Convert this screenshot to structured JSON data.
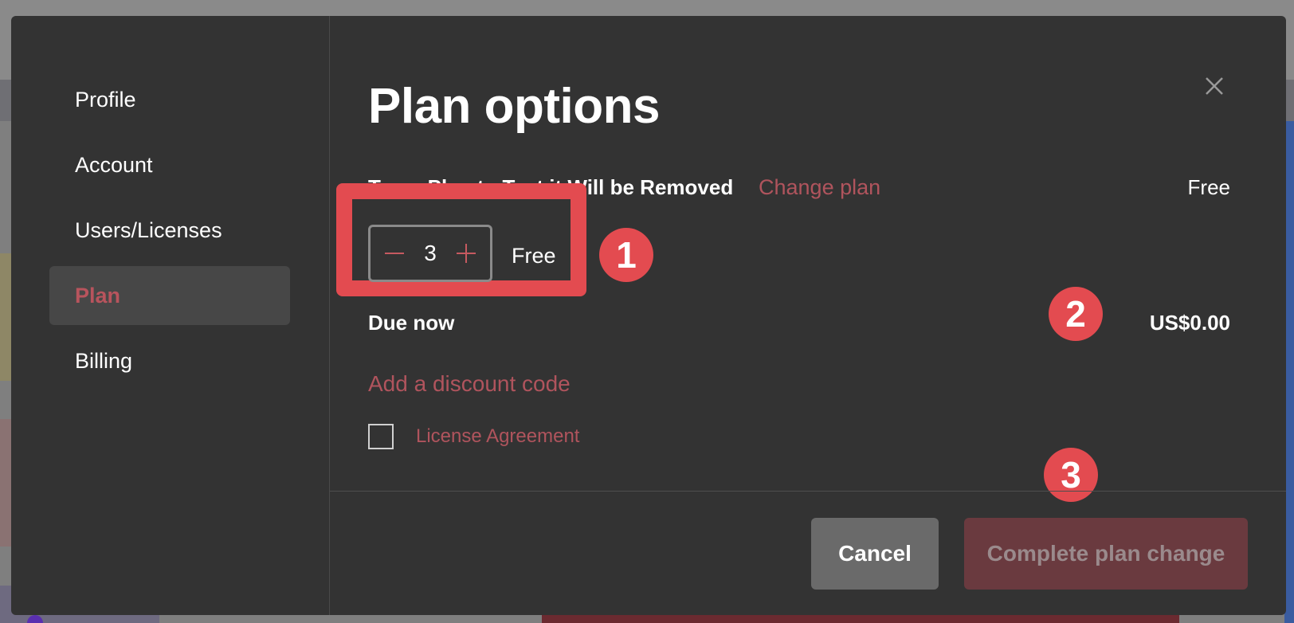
{
  "sidebar": {
    "items": [
      {
        "label": "Profile"
      },
      {
        "label": "Account"
      },
      {
        "label": "Users/Licenses"
      },
      {
        "label": "Plan"
      },
      {
        "label": "Billing"
      }
    ],
    "active": "Plan"
  },
  "main": {
    "title": "Plan options",
    "plan_name": "Temp Plan to Test it Will be Removed",
    "change_plan_label": "Change plan",
    "plan_price": "Free",
    "quantity": "3",
    "quantity_price": "Free",
    "due_now_label": "Due now",
    "due_now_amount": "US$0.00",
    "discount_label": "Add a discount code",
    "license_label": "License Agreement",
    "license_checked": false
  },
  "footer": {
    "cancel_label": "Cancel",
    "complete_label": "Complete plan change"
  },
  "annotations": {
    "badge_1": "1",
    "badge_2": "2",
    "badge_3": "3"
  },
  "colors": {
    "accent": "#b0545d",
    "highlight": "#e34b50",
    "modal_bg": "#333333"
  }
}
